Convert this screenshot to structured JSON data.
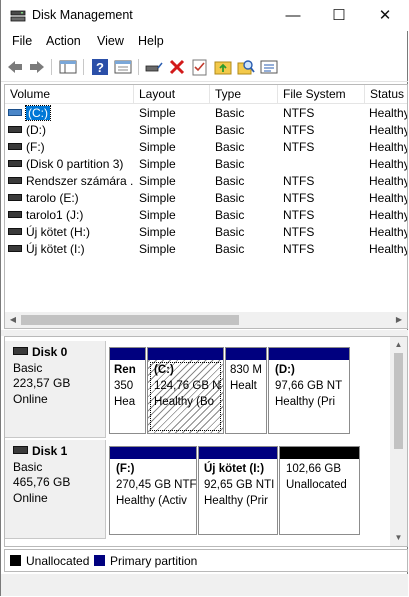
{
  "window": {
    "title": "Disk Management"
  },
  "titlebar": {
    "minimize": "—",
    "maximize": "☐",
    "close": "✕"
  },
  "menu": [
    {
      "label": "File"
    },
    {
      "label": "Action"
    },
    {
      "label": "View"
    },
    {
      "label": "Help"
    }
  ],
  "toolbar": {
    "icons": [
      "back-icon",
      "forward-icon",
      "show-hide-console-tree-icon",
      "help-icon",
      "properties-icon",
      "connect-drive-icon",
      "delete-icon",
      "check-icon",
      "folder-up-icon",
      "search-icon",
      "rescan-icon"
    ]
  },
  "volume_list": {
    "columns": [
      "Volume",
      "Layout",
      "Type",
      "File System",
      "Status"
    ],
    "rows": [
      {
        "volume": "(C:)",
        "layout": "Simple",
        "type": "Basic",
        "fs": "NTFS",
        "status": "Healthy"
      },
      {
        "volume": "(D:)",
        "layout": "Simple",
        "type": "Basic",
        "fs": "NTFS",
        "status": "Healthy"
      },
      {
        "volume": "(F:)",
        "layout": "Simple",
        "type": "Basic",
        "fs": "NTFS",
        "status": "Healthy"
      },
      {
        "volume": "(Disk 0 partition 3)",
        "layout": "Simple",
        "type": "Basic",
        "fs": "",
        "status": "Healthy"
      },
      {
        "volume": "Rendszer számára ...",
        "layout": "Simple",
        "type": "Basic",
        "fs": "NTFS",
        "status": "Healthy"
      },
      {
        "volume": "tarolo (E:)",
        "layout": "Simple",
        "type": "Basic",
        "fs": "NTFS",
        "status": "Healthy"
      },
      {
        "volume": "tarolo1 (J:)",
        "layout": "Simple",
        "type": "Basic",
        "fs": "NTFS",
        "status": "Healthy"
      },
      {
        "volume": "Új kötet (H:)",
        "layout": "Simple",
        "type": "Basic",
        "fs": "NTFS",
        "status": "Healthy"
      },
      {
        "volume": "Új kötet (I:)",
        "layout": "Simple",
        "type": "Basic",
        "fs": "NTFS",
        "status": "Healthy"
      }
    ]
  },
  "disks": [
    {
      "name": "Disk 0",
      "type": "Basic",
      "size": "223,57 GB",
      "state": "Online",
      "partitions": [
        {
          "name": "Ren",
          "size": "350",
          "status": "Hea",
          "kind": "primary"
        },
        {
          "name": "(C:)",
          "size": "124,76 GB N",
          "status": "Healthy (Bo",
          "kind": "primary-selected"
        },
        {
          "name": "",
          "size": "830 M",
          "status": "Healt",
          "kind": "primary"
        },
        {
          "name": "(D:)",
          "size": "97,66 GB NT",
          "status": "Healthy (Pri",
          "kind": "primary"
        }
      ]
    },
    {
      "name": "Disk 1",
      "type": "Basic",
      "size": "465,76 GB",
      "state": "Online",
      "partitions": [
        {
          "name": "(F:)",
          "size": "270,45 GB NTF",
          "status": "Healthy (Activ",
          "kind": "primary"
        },
        {
          "name": "Új kötet  (I:)",
          "size": "92,65 GB NTI",
          "status": "Healthy (Prir",
          "kind": "primary"
        },
        {
          "name": "",
          "size": "102,66 GB",
          "status": "Unallocated",
          "kind": "unallocated"
        }
      ]
    }
  ],
  "legend": [
    {
      "label": "Unallocated",
      "color": "#000000"
    },
    {
      "label": "Primary partition",
      "color": "#00007f"
    }
  ]
}
